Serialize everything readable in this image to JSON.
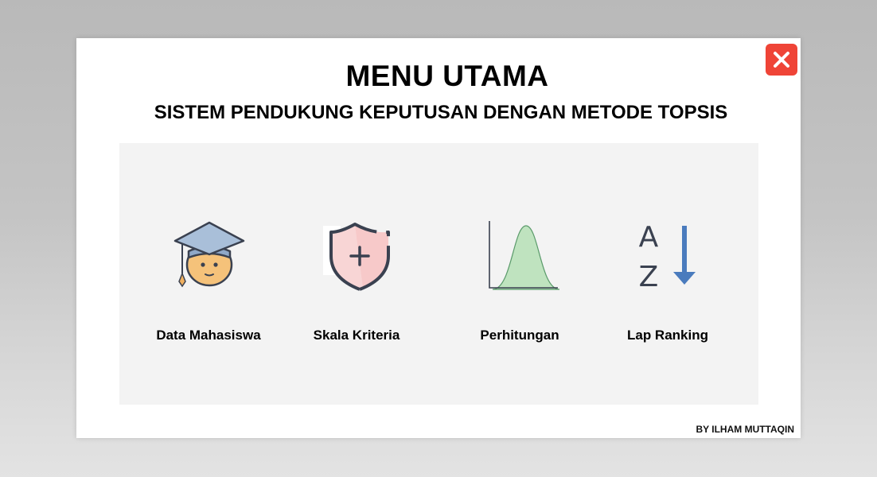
{
  "header": {
    "title": "MENU UTAMA",
    "subtitle": "SISTEM PENDUKUNG KEPUTUSAN DENGAN METODE TOPSIS"
  },
  "menu": {
    "items": [
      {
        "label": "Data Mahasiswa",
        "icon": "graduate-student-icon"
      },
      {
        "label": "Skala Kriteria",
        "icon": "shield-plus-icon"
      },
      {
        "label": "Perhitungan",
        "icon": "bell-curve-icon"
      },
      {
        "label": "Lap Ranking",
        "icon": "sort-a-z-icon"
      }
    ]
  },
  "footer": {
    "credit": "BY ILHAM MUTTAQIN"
  },
  "colors": {
    "close_button": "#ef4437",
    "panel_background": "#f3f3f3",
    "cap": "#8fa8c8",
    "face": "#f5c27a",
    "shield_fill": "#f8d5d5",
    "curve_fill": "#bfe3bf",
    "arrow": "#4a7bbd",
    "text_dark": "#3a4150"
  }
}
